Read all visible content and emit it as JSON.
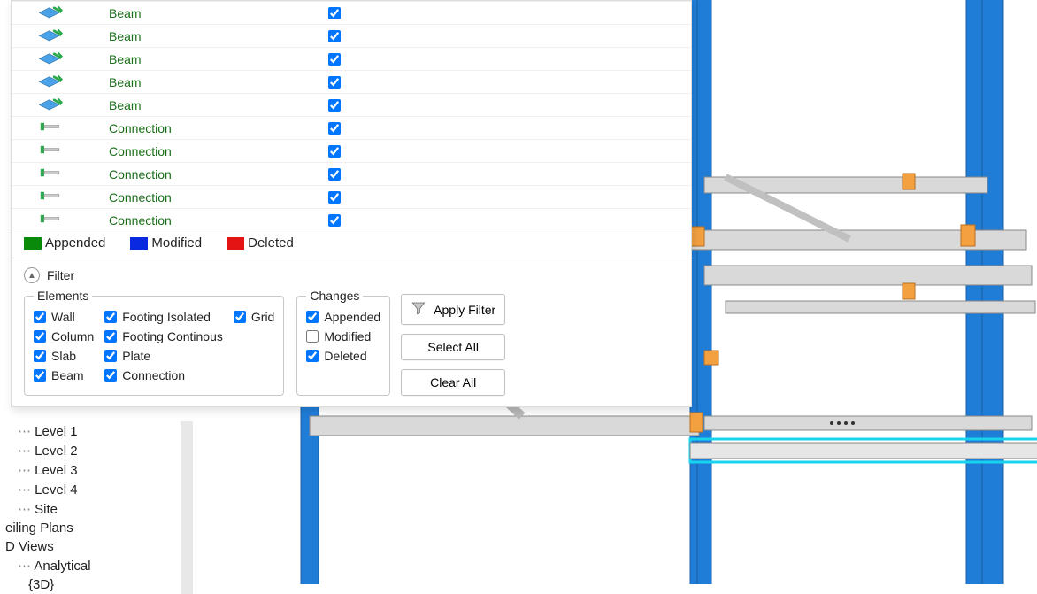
{
  "table": {
    "rows": [
      {
        "kind": "beam",
        "label": "Beam",
        "checked": true,
        "status": "appended"
      },
      {
        "kind": "beam",
        "label": "Beam",
        "checked": true,
        "status": "appended"
      },
      {
        "kind": "beam",
        "label": "Beam",
        "checked": true,
        "status": "appended"
      },
      {
        "kind": "beam",
        "label": "Beam",
        "checked": true,
        "status": "appended"
      },
      {
        "kind": "beam",
        "label": "Beam",
        "checked": true,
        "status": "appended"
      },
      {
        "kind": "conn",
        "label": "Connection",
        "checked": true,
        "status": "appended"
      },
      {
        "kind": "conn",
        "label": "Connection",
        "checked": true,
        "status": "appended"
      },
      {
        "kind": "conn",
        "label": "Connection",
        "checked": true,
        "status": "appended"
      },
      {
        "kind": "conn",
        "label": "Connection",
        "checked": true,
        "status": "appended"
      },
      {
        "kind": "conn",
        "label": "Connection",
        "checked": true,
        "status": "appended"
      }
    ]
  },
  "legend": {
    "appended_color": "#0a8a0a",
    "appended_label": "Appended",
    "modified_color": "#0929e0",
    "modified_label": "Modified",
    "deleted_color": "#e31414",
    "deleted_label": "Deleted"
  },
  "filter": {
    "header": "Filter",
    "elements_group": "Elements",
    "changes_group": "Changes",
    "elements": {
      "wall": {
        "label": "Wall",
        "checked": true
      },
      "column": {
        "label": "Column",
        "checked": true
      },
      "slab": {
        "label": "Slab",
        "checked": true
      },
      "beam": {
        "label": "Beam",
        "checked": true
      },
      "footing_isolated": {
        "label": "Footing Isolated",
        "checked": true
      },
      "footing_continous": {
        "label": "Footing Continous",
        "checked": true
      },
      "plate": {
        "label": "Plate",
        "checked": true
      },
      "connection": {
        "label": "Connection",
        "checked": true
      },
      "grid": {
        "label": "Grid",
        "checked": true
      }
    },
    "changes": {
      "appended": {
        "label": "Appended",
        "checked": true
      },
      "modified": {
        "label": "Modified",
        "checked": false
      },
      "deleted": {
        "label": "Deleted",
        "checked": true
      }
    },
    "apply_label": "Apply Filter",
    "select_all_label": "Select All",
    "clear_all_label": "Clear All"
  },
  "browser": {
    "items": [
      {
        "text": "Level 1",
        "indent": 1,
        "marker": "⋯"
      },
      {
        "text": "Level 2",
        "indent": 1,
        "marker": "⋯"
      },
      {
        "text": "Level 3",
        "indent": 1,
        "marker": "⋯"
      },
      {
        "text": "Level 4",
        "indent": 1,
        "marker": "⋯"
      },
      {
        "text": "Site",
        "indent": 1,
        "marker": "⋯"
      },
      {
        "text": "eiling Plans",
        "indent": 0,
        "marker": ""
      },
      {
        "text": "D Views",
        "indent": 0,
        "marker": ""
      },
      {
        "text": "Analytical",
        "indent": 1,
        "marker": "⋯"
      },
      {
        "text": "{3D}",
        "indent": 2,
        "marker": ""
      }
    ]
  }
}
